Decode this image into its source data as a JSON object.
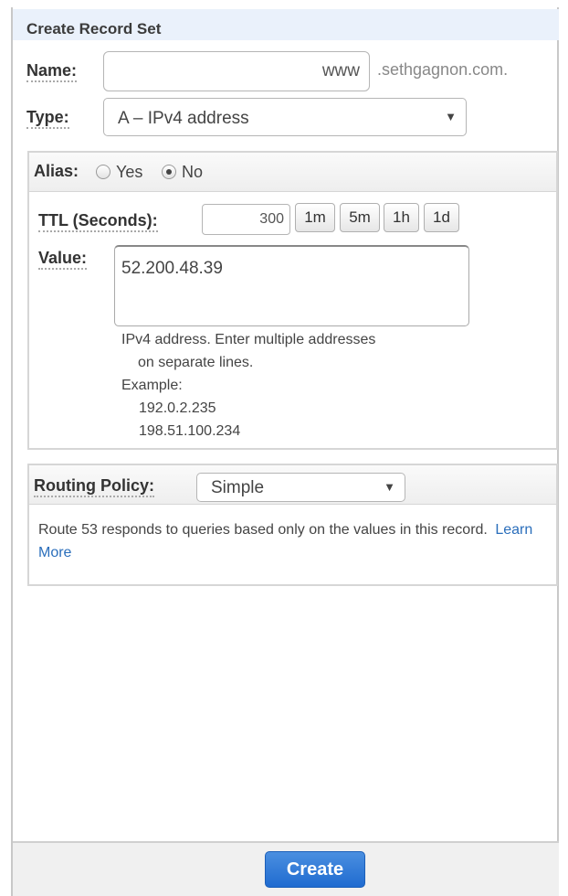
{
  "form": {
    "title": "Create Record Set",
    "name": {
      "label": "Name:",
      "value": "www",
      "suffix": ".sethgagnon.com."
    },
    "type": {
      "label": "Type:",
      "selected": "A – IPv4 address"
    }
  },
  "alias": {
    "label": "Alias:",
    "options": [
      {
        "label": "Yes",
        "checked": false
      },
      {
        "label": "No",
        "checked": true
      }
    ]
  },
  "ttl": {
    "label": "TTL (Seconds):",
    "value": "300",
    "presets": [
      "1m",
      "5m",
      "1h",
      "1d"
    ]
  },
  "value_field": {
    "label": "Value:",
    "value": "52.200.48.39",
    "help_line1": "IPv4 address. Enter multiple addresses",
    "help_line2": "on separate lines.",
    "example_label": "Example:",
    "examples": [
      "192.0.2.235",
      "198.51.100.234"
    ]
  },
  "routing": {
    "label": "Routing Policy:",
    "selected": "Simple",
    "description": "Route 53 responds to queries based only on the values in this record.",
    "learn_more": "Learn",
    "learn_more_2": "More"
  },
  "footer": {
    "create_label": "Create"
  },
  "icons": {
    "dropdown": "caret-down-icon"
  },
  "colors": {
    "primary_button": "#1f6bd0",
    "link": "#2a6ebb",
    "header_bg": "#eaf1fb"
  }
}
